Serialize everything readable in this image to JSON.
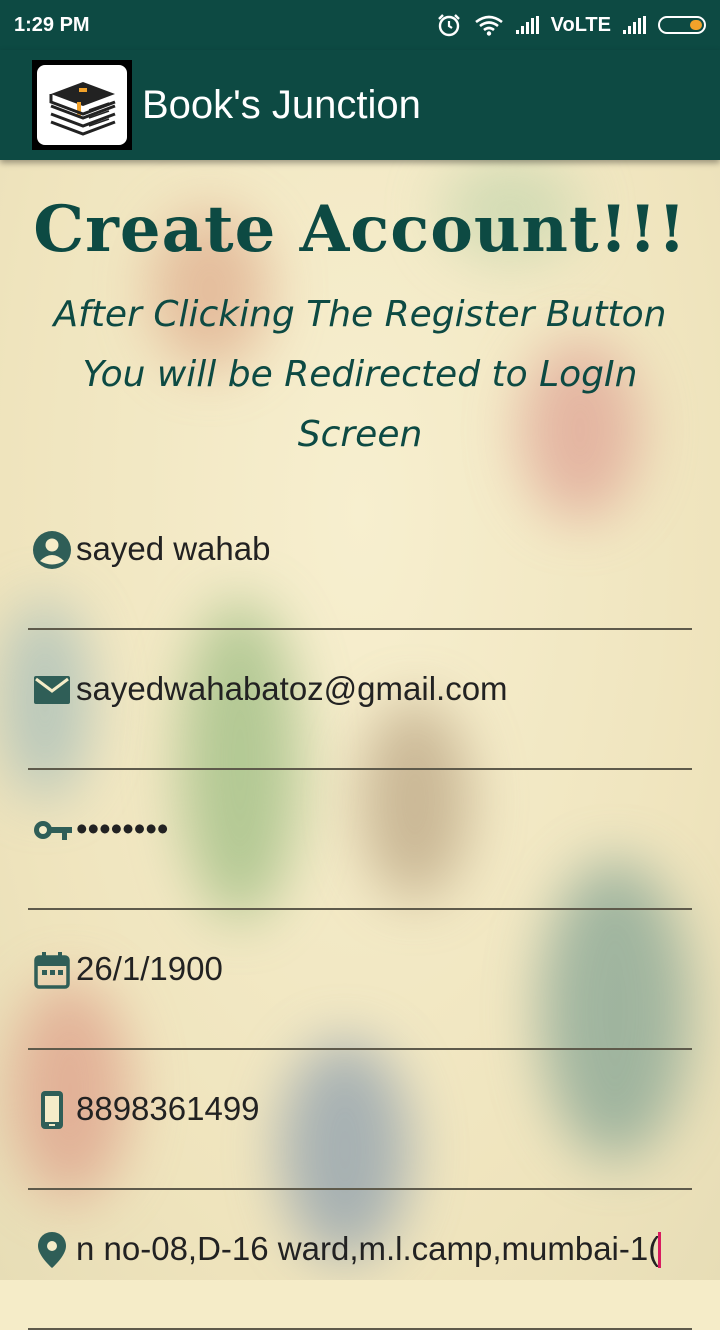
{
  "status_bar": {
    "time": "1:29 PM",
    "network": "VoLTE",
    "icons": [
      "alarm-icon",
      "wifi-icon",
      "signal-icon",
      "signal-icon",
      "battery-icon"
    ]
  },
  "app_bar": {
    "title": "Book's Junction",
    "logo": "books-stack-icon",
    "background": "#0d4a43"
  },
  "form": {
    "heading": "Create Account!!!",
    "subtitle": "After Clicking The Register Button You will be Redirected to LogIn Screen",
    "fields": [
      {
        "icon": "person-icon",
        "value": "sayed wahab"
      },
      {
        "icon": "email-icon",
        "value": "sayedwahabatoz@gmail.com"
      },
      {
        "icon": "key-icon",
        "value": "••••••••"
      },
      {
        "icon": "calendar-icon",
        "value": "26/1/1900"
      },
      {
        "icon": "phone-icon",
        "value": "8898361499"
      },
      {
        "icon": "location-icon",
        "value": "n no-08,D-16 ward,m.l.camp,mumbai-1("
      }
    ]
  },
  "colors": {
    "primary": "#0d4a43",
    "accent_cursor": "#d81b60",
    "battery": "#f2a22a",
    "background": "#f5ecc8"
  }
}
